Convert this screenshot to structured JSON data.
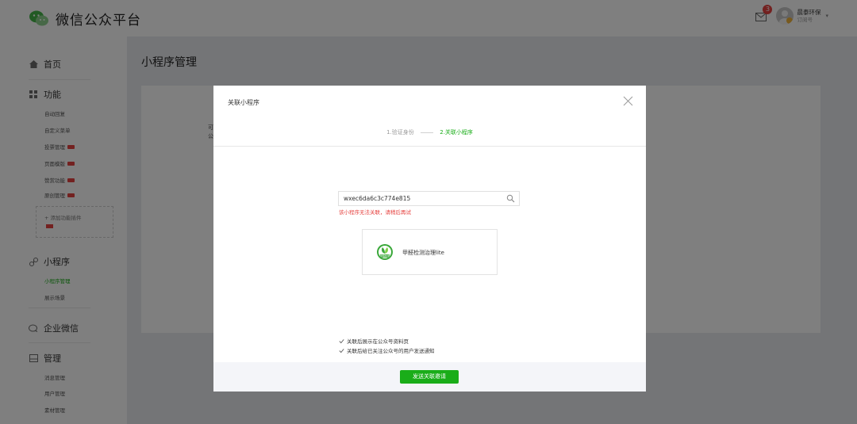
{
  "header": {
    "brand": "微信公众平台",
    "notification_count": "3",
    "user_name": "晨泰环保",
    "account_type": "订阅号"
  },
  "sidebar": {
    "home": "首页",
    "features": {
      "title": "功能",
      "items": [
        {
          "label": "自动回复",
          "new": false
        },
        {
          "label": "自定义菜单",
          "new": false
        },
        {
          "label": "投票管理",
          "new": true
        },
        {
          "label": "页面模版",
          "new": true
        },
        {
          "label": "赞赏功能",
          "new": true
        },
        {
          "label": "原创管理",
          "new": true
        }
      ],
      "add_plugin": "+ 添加功能插件"
    },
    "miniprogram": {
      "title": "小程序",
      "items": [
        {
          "label": "小程序管理",
          "active": true
        },
        {
          "label": "展示场景",
          "active": false
        }
      ]
    },
    "wework": {
      "title": "企业微信"
    },
    "management": {
      "title": "管理",
      "items": [
        {
          "label": "消息管理"
        },
        {
          "label": "用户管理"
        },
        {
          "label": "素材管理"
        }
      ]
    }
  },
  "main": {
    "title": "小程序管理",
    "panel_fragments": [
      "可",
      "公"
    ]
  },
  "dialog": {
    "title": "关联小程序",
    "steps": [
      "1.验证身份",
      "2.关联小程序"
    ],
    "search_value": "wxec6da6c3c774e815",
    "error": "该小程序无法关联，请稍后再试",
    "result_name": "甲醛检测治理lite",
    "logo_label": "甲醛检测",
    "checkboxes": [
      {
        "label": "关联后展示在公众号资料页",
        "checked": true
      },
      {
        "label": "关联后给已关注公众号的用户发送通知",
        "checked": true
      }
    ],
    "send_button": "发送关联邀请"
  },
  "colors": {
    "accent_green": "#1aad19",
    "error_red": "#e64340",
    "overlay": "rgba(0,0,0,0.5)"
  }
}
